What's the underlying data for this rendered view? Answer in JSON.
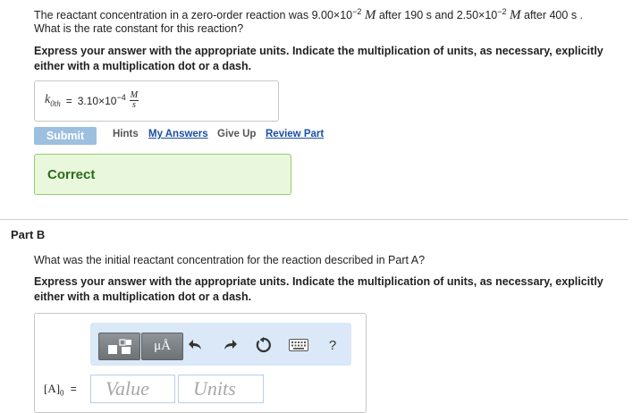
{
  "partA": {
    "question_line1_a": "The reactant concentration in a zero-order reaction was 9.00×10",
    "question_exp1": "−2",
    "question_unit1": "M",
    "question_line1_b": "after 190 s and 2.50×10",
    "question_exp2": "−2",
    "question_unit2": "M",
    "question_line1_c": "after 400 s .",
    "question_line2": "What is the rate constant for this reaction?",
    "instruction_line1": "Express your answer with the appropriate units. Indicate the multiplication of units, as necessary, explicitly",
    "instruction_line2": "either with a multiplication dot or a dash.",
    "answer_symbol": "k",
    "answer_subscript": "0th",
    "answer_equals": "=",
    "answer_value": "3.10×10",
    "answer_exponent": "−4",
    "answer_unit_num": "M",
    "answer_unit_den": "s",
    "submit_label": "Submit",
    "hints_label": "Hints",
    "my_answers_label": "My Answers",
    "give_up_label": "Give Up",
    "review_part_label": "Review Part",
    "feedback": "Correct"
  },
  "partB": {
    "title": "Part B",
    "question": "What was the initial reactant concentration for the reaction described in Part A?",
    "instruction_line1": "Express your answer with the appropriate units. Indicate the multiplication of units, as necessary, explicitly",
    "instruction_line2": "either with a multiplication dot or a dash.",
    "toolbar": {
      "templates_icon": "templates-icon",
      "units_label": "μÅ",
      "undo_icon": "undo-icon",
      "redo_icon": "redo-icon",
      "reset_icon": "reset-icon",
      "keyboard_icon": "keyboard-icon",
      "help_label": "?"
    },
    "input_label_main": "[A]",
    "input_label_sub": "0",
    "input_label_eq": "=",
    "value_placeholder": "Value",
    "units_placeholder": "Units"
  }
}
